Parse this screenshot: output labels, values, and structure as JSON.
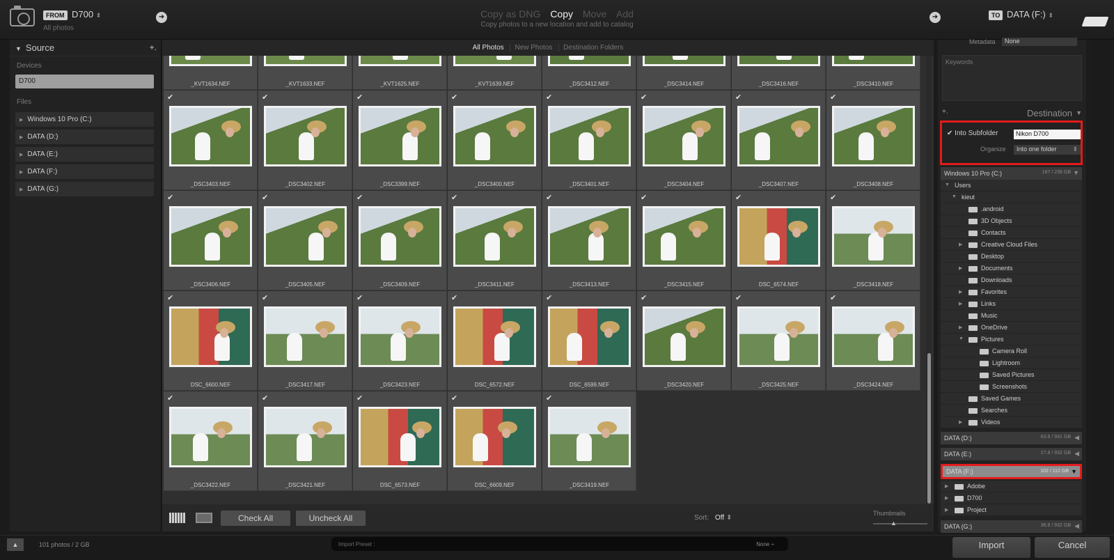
{
  "topbar": {
    "from_tag": "FROM",
    "source_name": "D700",
    "source_sub": "All photos",
    "modes": [
      "Copy as DNG",
      "Copy",
      "Move",
      "Add"
    ],
    "active_mode": "Copy",
    "mode_description": "Copy photos to a new location and add to catalog",
    "to_tag": "TO",
    "dest_name": "DATA (F:)"
  },
  "source": {
    "title": "Source",
    "devices_label": "Devices",
    "device": "D700",
    "files_label": "Files",
    "volumes": [
      "Windows 10 Pro (C:)",
      "DATA (D:)",
      "DATA (E:)",
      "DATA (F:)",
      "DATA (G:)"
    ]
  },
  "tabs": [
    "All Photos",
    "New Photos",
    "Destination Folders"
  ],
  "photos": [
    {
      "name": "_KVT1634.NEF",
      "checked": false,
      "style": "ph-b"
    },
    {
      "name": "_KVT1633.NEF",
      "checked": false,
      "style": "ph-b"
    },
    {
      "name": "_KVT1625.NEF",
      "checked": false,
      "style": "ph-b"
    },
    {
      "name": "_KVT1639.NEF",
      "checked": false,
      "style": "ph-b"
    },
    {
      "name": "_DSC3412.NEF",
      "checked": false,
      "style": "ph-a"
    },
    {
      "name": "_DSC3414.NEF",
      "checked": false,
      "style": "ph-a"
    },
    {
      "name": "_DSC3416.NEF",
      "checked": false,
      "style": "ph-a"
    },
    {
      "name": "_DSC3410.NEF",
      "checked": false,
      "style": "ph-a"
    },
    {
      "name": "_DSC3403.NEF",
      "checked": true,
      "style": "ph-a"
    },
    {
      "name": "_DSC3402.NEF",
      "checked": true,
      "style": "ph-a"
    },
    {
      "name": "_DSC3399.NEF",
      "checked": true,
      "style": "ph-a"
    },
    {
      "name": "_DSC3400.NEF",
      "checked": true,
      "style": "ph-a"
    },
    {
      "name": "_DSC3401.NEF",
      "checked": true,
      "style": "ph-a"
    },
    {
      "name": "_DSC3404.NEF",
      "checked": true,
      "style": "ph-a"
    },
    {
      "name": "_DSC3407.NEF",
      "checked": true,
      "style": "ph-a"
    },
    {
      "name": "_DSC3408.NEF",
      "checked": true,
      "style": "ph-a"
    },
    {
      "name": "_DSC3406.NEF",
      "checked": true,
      "style": "ph-a"
    },
    {
      "name": "_DSC3405.NEF",
      "checked": true,
      "style": "ph-a"
    },
    {
      "name": "_DSC3409.NEF",
      "checked": true,
      "style": "ph-a"
    },
    {
      "name": "_DSC3411.NEF",
      "checked": true,
      "style": "ph-a"
    },
    {
      "name": "_DSC3413.NEF",
      "checked": true,
      "style": "ph-a"
    },
    {
      "name": "_DSC3415.NEF",
      "checked": true,
      "style": "ph-a"
    },
    {
      "name": "DSC_6574.NEF",
      "checked": true,
      "style": "ph-c"
    },
    {
      "name": "_DSC3418.NEF",
      "checked": true,
      "style": "ph-d"
    },
    {
      "name": "DSC_6600.NEF",
      "checked": true,
      "style": "ph-c"
    },
    {
      "name": "_DSC3417.NEF",
      "checked": true,
      "style": "ph-d"
    },
    {
      "name": "_DSC3423.NEF",
      "checked": true,
      "style": "ph-d"
    },
    {
      "name": "DSC_6572.NEF",
      "checked": true,
      "style": "ph-c"
    },
    {
      "name": "DSC_6599.NEF",
      "checked": true,
      "style": "ph-c"
    },
    {
      "name": "_DSC3420.NEF",
      "checked": true,
      "style": "ph-a"
    },
    {
      "name": "_DSC3425.NEF",
      "checked": true,
      "style": "ph-d"
    },
    {
      "name": "_DSC3424.NEF",
      "checked": true,
      "style": "ph-d"
    },
    {
      "name": "_DSC3422.NEF",
      "checked": true,
      "style": "ph-d"
    },
    {
      "name": "_DSC3421.NEF",
      "checked": true,
      "style": "ph-d"
    },
    {
      "name": "DSC_6573.NEF",
      "checked": true,
      "style": "ph-c"
    },
    {
      "name": "DSC_6609.NEF",
      "checked": true,
      "style": "ph-c"
    },
    {
      "name": "_DSC3419.NEF",
      "checked": true,
      "style": "ph-d"
    }
  ],
  "bottombar": {
    "check_all": "Check All",
    "uncheck_all": "Uncheck All",
    "sort_label": "Sort:",
    "sort_value": "Off",
    "thumbnails_label": "Thumbnails"
  },
  "right": {
    "metadata_label": "Metadata",
    "metadata_value": "None",
    "keywords_label": "Keywords",
    "destination_title": "Destination",
    "into_subfolder_label": "Into Subfolder",
    "subfolder_value": "Nikon D700",
    "organize_label": "Organize",
    "organize_value": "Into one folder",
    "vol_c": {
      "name": "Windows 10 Pro (C:)",
      "size": "187 / 238 GB"
    },
    "tree_c": [
      {
        "label": "Users",
        "indent": 6,
        "exp": "▼",
        "folder": false
      },
      {
        "label": "kieut",
        "indent": 16,
        "exp": "▼",
        "folder": false
      },
      {
        "label": ".android",
        "indent": 26,
        "exp": "",
        "folder": true
      },
      {
        "label": "3D Objects",
        "indent": 26,
        "exp": "",
        "folder": true
      },
      {
        "label": "Contacts",
        "indent": 26,
        "exp": "",
        "folder": true
      },
      {
        "label": "Creative Cloud Files",
        "indent": 26,
        "exp": "▶",
        "folder": true
      },
      {
        "label": "Desktop",
        "indent": 26,
        "exp": "",
        "folder": true
      },
      {
        "label": "Documents",
        "indent": 26,
        "exp": "▶",
        "folder": true
      },
      {
        "label": "Downloads",
        "indent": 26,
        "exp": "",
        "folder": true
      },
      {
        "label": "Favorites",
        "indent": 26,
        "exp": "▶",
        "folder": true
      },
      {
        "label": "Links",
        "indent": 26,
        "exp": "▶",
        "folder": true
      },
      {
        "label": "Music",
        "indent": 26,
        "exp": "",
        "folder": true
      },
      {
        "label": "OneDrive",
        "indent": 26,
        "exp": "▶",
        "folder": true
      },
      {
        "label": "Pictures",
        "indent": 26,
        "exp": "▼",
        "folder": true
      },
      {
        "label": "Camera Roll",
        "indent": 42,
        "exp": "",
        "folder": true
      },
      {
        "label": "Lightroom",
        "indent": 42,
        "exp": "",
        "folder": true
      },
      {
        "label": "Saved Pictures",
        "indent": 42,
        "exp": "",
        "folder": true
      },
      {
        "label": "Screenshots",
        "indent": 42,
        "exp": "",
        "folder": true
      },
      {
        "label": "Saved Games",
        "indent": 26,
        "exp": "",
        "folder": true
      },
      {
        "label": "Searches",
        "indent": 26,
        "exp": "",
        "folder": true
      },
      {
        "label": "Videos",
        "indent": 26,
        "exp": "▶",
        "folder": true
      }
    ],
    "vol_d": {
      "name": "DATA (D:)",
      "size": "63.6 / 931 GB"
    },
    "vol_e": {
      "name": "DATA (E:)",
      "size": "27.8 / 932 GB"
    },
    "vol_f": {
      "name": "DATA (F:)",
      "size": "102 / 112 GB"
    },
    "tree_f": [
      {
        "label": "Adobe",
        "indent": 6,
        "exp": "▶",
        "folder": true
      },
      {
        "label": "D700",
        "indent": 6,
        "exp": "▶",
        "folder": true
      },
      {
        "label": "Project",
        "indent": 6,
        "exp": "▶",
        "folder": true
      }
    ],
    "vol_g": {
      "name": "DATA (G:)",
      "size": "36.8 / 932 GB"
    }
  },
  "footer": {
    "photo_count": "101 photos / 2 GB",
    "preset_label": "Import Preset :",
    "preset_value": "None ÷",
    "import_button": "Import",
    "cancel_button": "Cancel"
  },
  "colors": {
    "highlight": "#e31b1b",
    "panel": "#222222",
    "grid": "#4a4a4a"
  }
}
